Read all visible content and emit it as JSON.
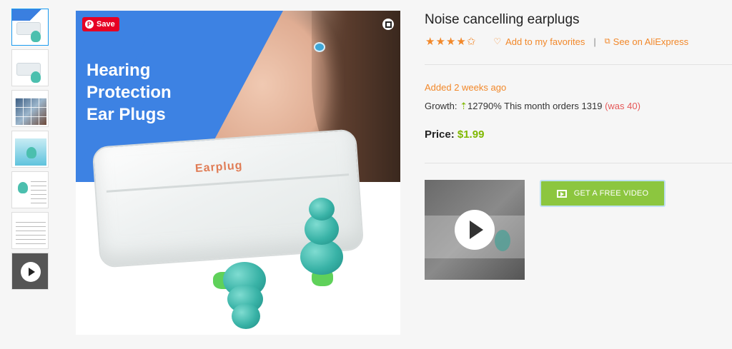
{
  "product": {
    "title": "Noise cancelling earplugs",
    "stars": "★★★★✩",
    "add_favorites_label": "Add to my favorites",
    "separator": "|",
    "see_on_label": "See on AliExpress",
    "added": "Added 2 weeks ago",
    "growth_label": "Growth:",
    "growth_arrow": "⇡",
    "growth_value": "12790%",
    "orders_label": "This month orders 1319",
    "was_label": "(was 40)",
    "price_label": "Price:",
    "price_value": "$1.99"
  },
  "main_image": {
    "headline_line1": "Hearing",
    "headline_line2": "Protection",
    "headline_line3": "Ear Plugs",
    "case_label": "Earplug",
    "save_label": "Save",
    "pin_glyph": "P"
  },
  "video": {
    "button_label": "GET A FREE VIDEO"
  },
  "colors": {
    "accent_orange": "#f2882a",
    "green": "#8cc63f",
    "pinterest_red": "#e60023",
    "banner_blue": "#3d82e3"
  }
}
